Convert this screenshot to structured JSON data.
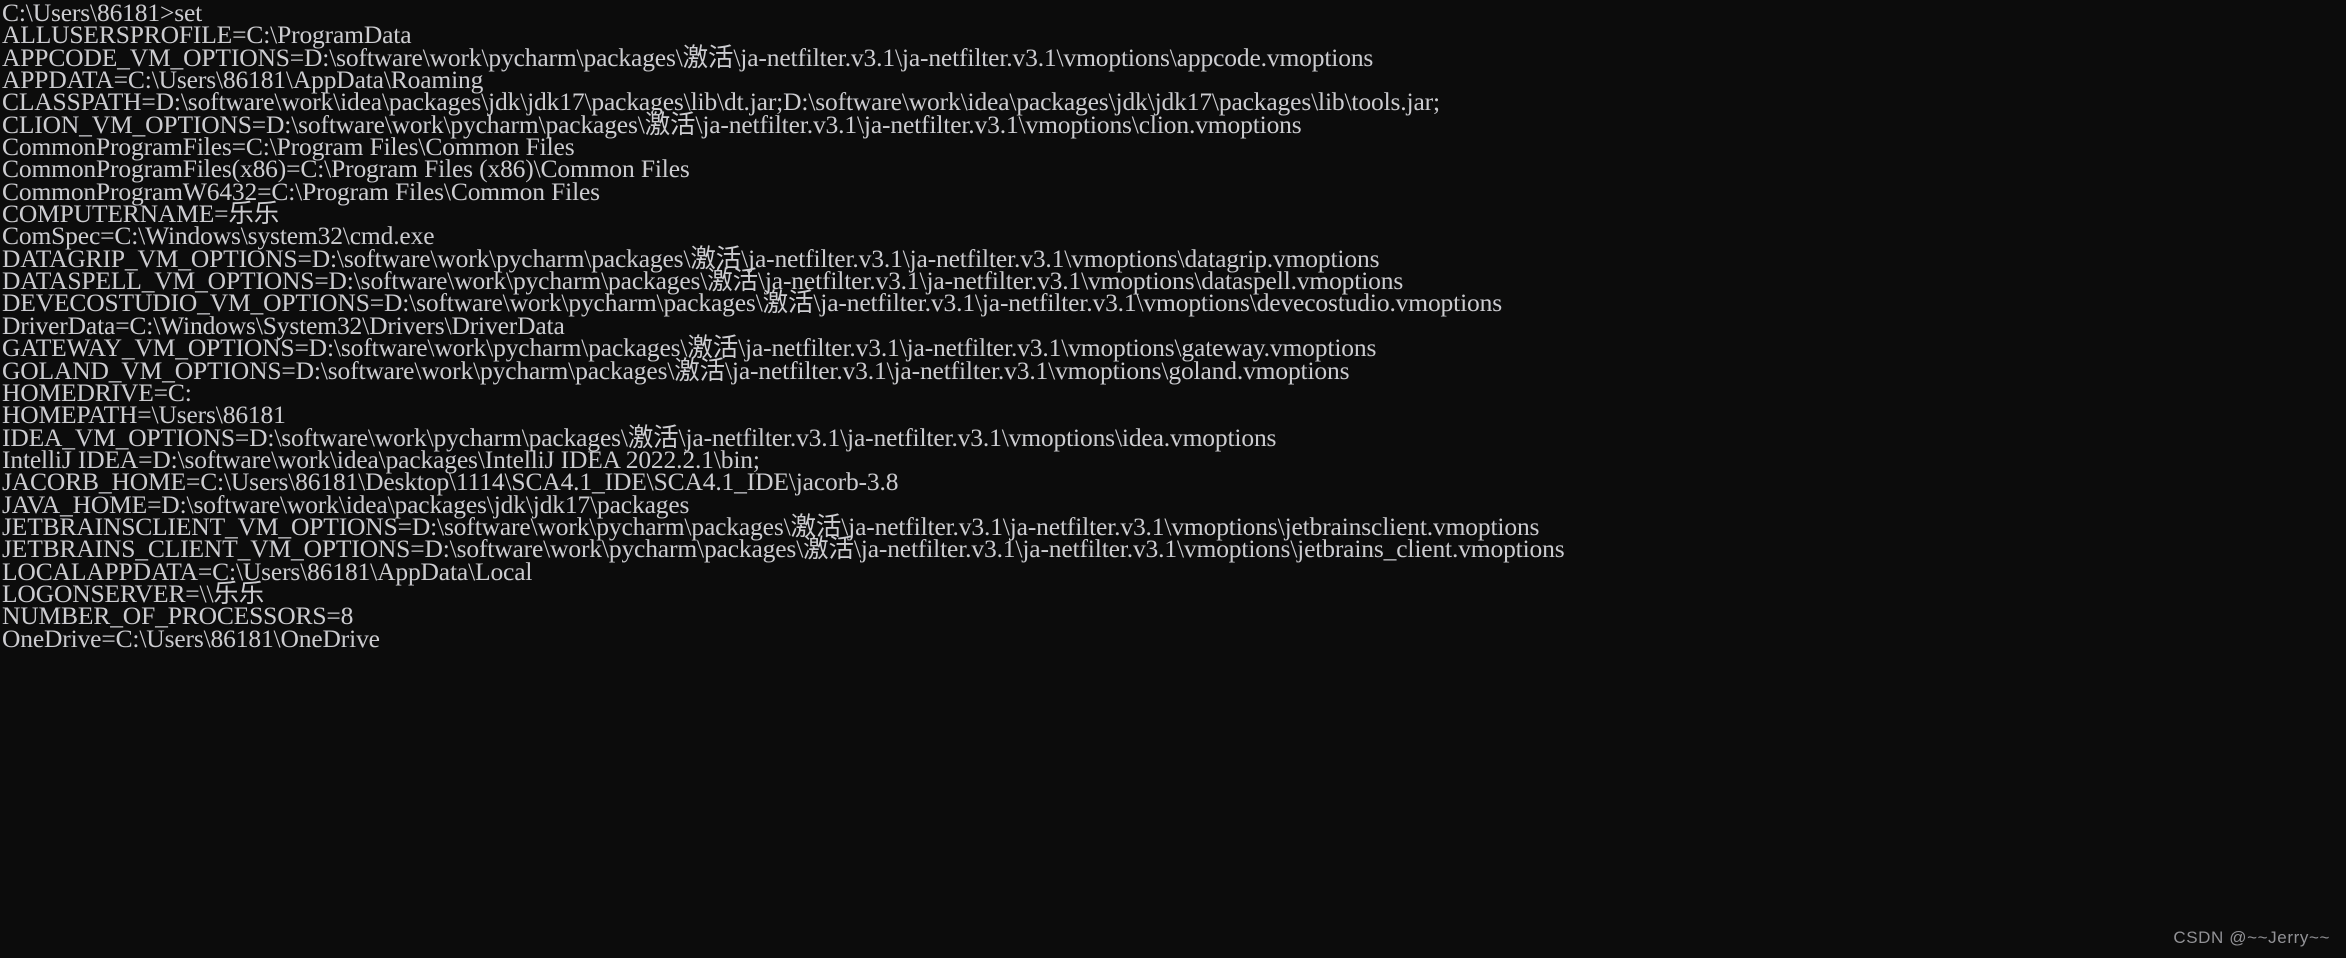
{
  "window": {
    "app": "Windows Command Prompt",
    "background_color": "#0c0c0c",
    "text_color": "#ccccd0"
  },
  "console": {
    "prompt_line": "C:\\Users\\86181>set",
    "lines": [
      "C:\\Users\\86181>set",
      "ALLUSERSPROFILE=C:\\ProgramData",
      "APPCODE_VM_OPTIONS=D:\\software\\work\\pycharm\\packages\\激活\\ja-netfilter.v3.1\\ja-netfilter.v3.1\\vmoptions\\appcode.vmoptions",
      "APPDATA=C:\\Users\\86181\\AppData\\Roaming",
      "CLASSPATH=D:\\software\\work\\idea\\packages\\jdk\\jdk17\\packages\\lib\\dt.jar;D:\\software\\work\\idea\\packages\\jdk\\jdk17\\packages\\lib\\tools.jar;",
      "CLION_VM_OPTIONS=D:\\software\\work\\pycharm\\packages\\激活\\ja-netfilter.v3.1\\ja-netfilter.v3.1\\vmoptions\\clion.vmoptions",
      "CommonProgramFiles=C:\\Program Files\\Common Files",
      "CommonProgramFiles(x86)=C:\\Program Files (x86)\\Common Files",
      "CommonProgramW6432=C:\\Program Files\\Common Files",
      "COMPUTERNAME=乐乐",
      "ComSpec=C:\\Windows\\system32\\cmd.exe",
      "DATAGRIP_VM_OPTIONS=D:\\software\\work\\pycharm\\packages\\激活\\ja-netfilter.v3.1\\ja-netfilter.v3.1\\vmoptions\\datagrip.vmoptions",
      "DATASPELL_VM_OPTIONS=D:\\software\\work\\pycharm\\packages\\激活\\ja-netfilter.v3.1\\ja-netfilter.v3.1\\vmoptions\\dataspell.vmoptions",
      "DEVECOSTUDIO_VM_OPTIONS=D:\\software\\work\\pycharm\\packages\\激活\\ja-netfilter.v3.1\\ja-netfilter.v3.1\\vmoptions\\devecostudio.vmoptions",
      "DriverData=C:\\Windows\\System32\\Drivers\\DriverData",
      "GATEWAY_VM_OPTIONS=D:\\software\\work\\pycharm\\packages\\激活\\ja-netfilter.v3.1\\ja-netfilter.v3.1\\vmoptions\\gateway.vmoptions",
      "GOLAND_VM_OPTIONS=D:\\software\\work\\pycharm\\packages\\激活\\ja-netfilter.v3.1\\ja-netfilter.v3.1\\vmoptions\\goland.vmoptions",
      "HOMEDRIVE=C:",
      "HOMEPATH=\\Users\\86181",
      "IDEA_VM_OPTIONS=D:\\software\\work\\pycharm\\packages\\激活\\ja-netfilter.v3.1\\ja-netfilter.v3.1\\vmoptions\\idea.vmoptions",
      "IntelliJ IDEA=D:\\software\\work\\idea\\packages\\IntelliJ IDEA 2022.2.1\\bin;",
      "JACORB_HOME=C:\\Users\\86181\\Desktop\\1114\\SCA4.1_IDE\\SCA4.1_IDE\\jacorb-3.8",
      "JAVA_HOME=D:\\software\\work\\idea\\packages\\jdk\\jdk17\\packages",
      "JETBRAINSCLIENT_VM_OPTIONS=D:\\software\\work\\pycharm\\packages\\激活\\ja-netfilter.v3.1\\ja-netfilter.v3.1\\vmoptions\\jetbrainsclient.vmoptions",
      "JETBRAINS_CLIENT_VM_OPTIONS=D:\\software\\work\\pycharm\\packages\\激活\\ja-netfilter.v3.1\\ja-netfilter.v3.1\\vmoptions\\jetbrains_client.vmoptions",
      "LOCALAPPDATA=C:\\Users\\86181\\AppData\\Local",
      "LOGONSERVER=\\\\乐乐",
      "NUMBER_OF_PROCESSORS=8",
      "OneDrive=C:\\Users\\86181\\OneDrive"
    ]
  },
  "watermark": {
    "text": "CSDN @~~Jerry~~"
  }
}
